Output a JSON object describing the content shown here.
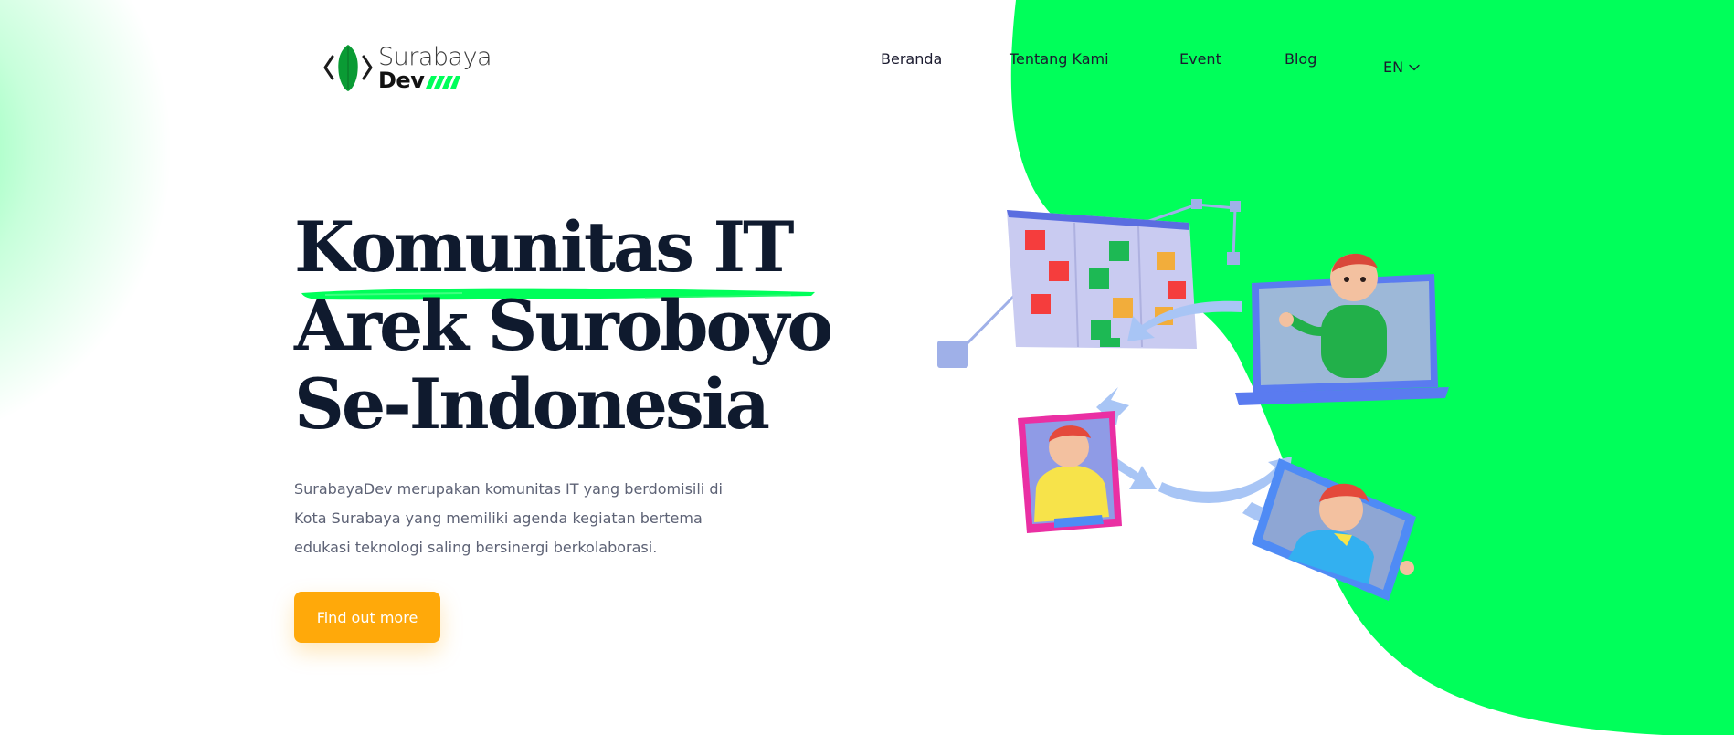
{
  "logo": {
    "line1": "Surabaya",
    "line2": "Dev"
  },
  "nav": {
    "items": [
      {
        "label": "Beranda"
      },
      {
        "label": "Tentang Kami"
      },
      {
        "label": "Event"
      },
      {
        "label": "Blog"
      }
    ],
    "language": "EN"
  },
  "hero": {
    "title_lines": [
      "Komunitas IT",
      "Arek Suroboyo",
      "Se-Indonesia"
    ],
    "description": "SurabayaDev merupakan komunitas IT yang berdomisili di Kota Surabaya yang memiliki agenda kegiatan bertema edukasi teknologi saling bersinergi berkolaborasi.",
    "cta_label": "Find out more"
  },
  "colors": {
    "accent_green": "#00ff5a",
    "cta_orange": "#ffa90a",
    "title_navy": "#0f1a2e"
  },
  "icons": [
    "code-bracket-left-icon",
    "leaf-icon",
    "code-bracket-right-icon",
    "chevron-down-icon"
  ]
}
